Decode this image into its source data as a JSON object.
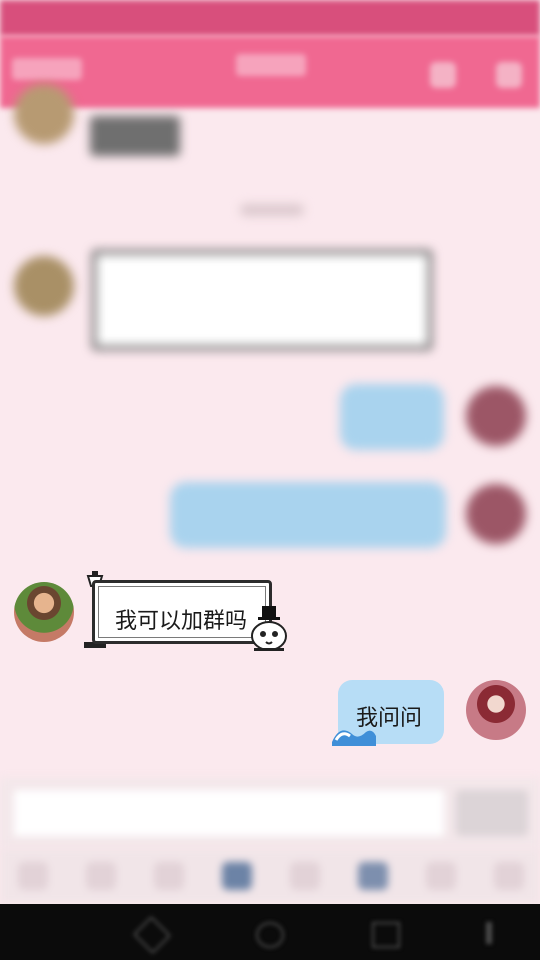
{
  "chat": {
    "messages": [
      {
        "side": "left",
        "text": "我可以加群吗"
      },
      {
        "side": "right",
        "text": "我问问"
      }
    ]
  },
  "icons": {
    "lamp": "street-lamp-sticker",
    "cat": "top-hat-cat-sticker",
    "wave": "wave-sticker"
  },
  "colors": {
    "accent": "#f06891",
    "status_bar": "#d84f7c",
    "right_bubble": "#b7ddf6",
    "background": "#fbe9ee"
  }
}
